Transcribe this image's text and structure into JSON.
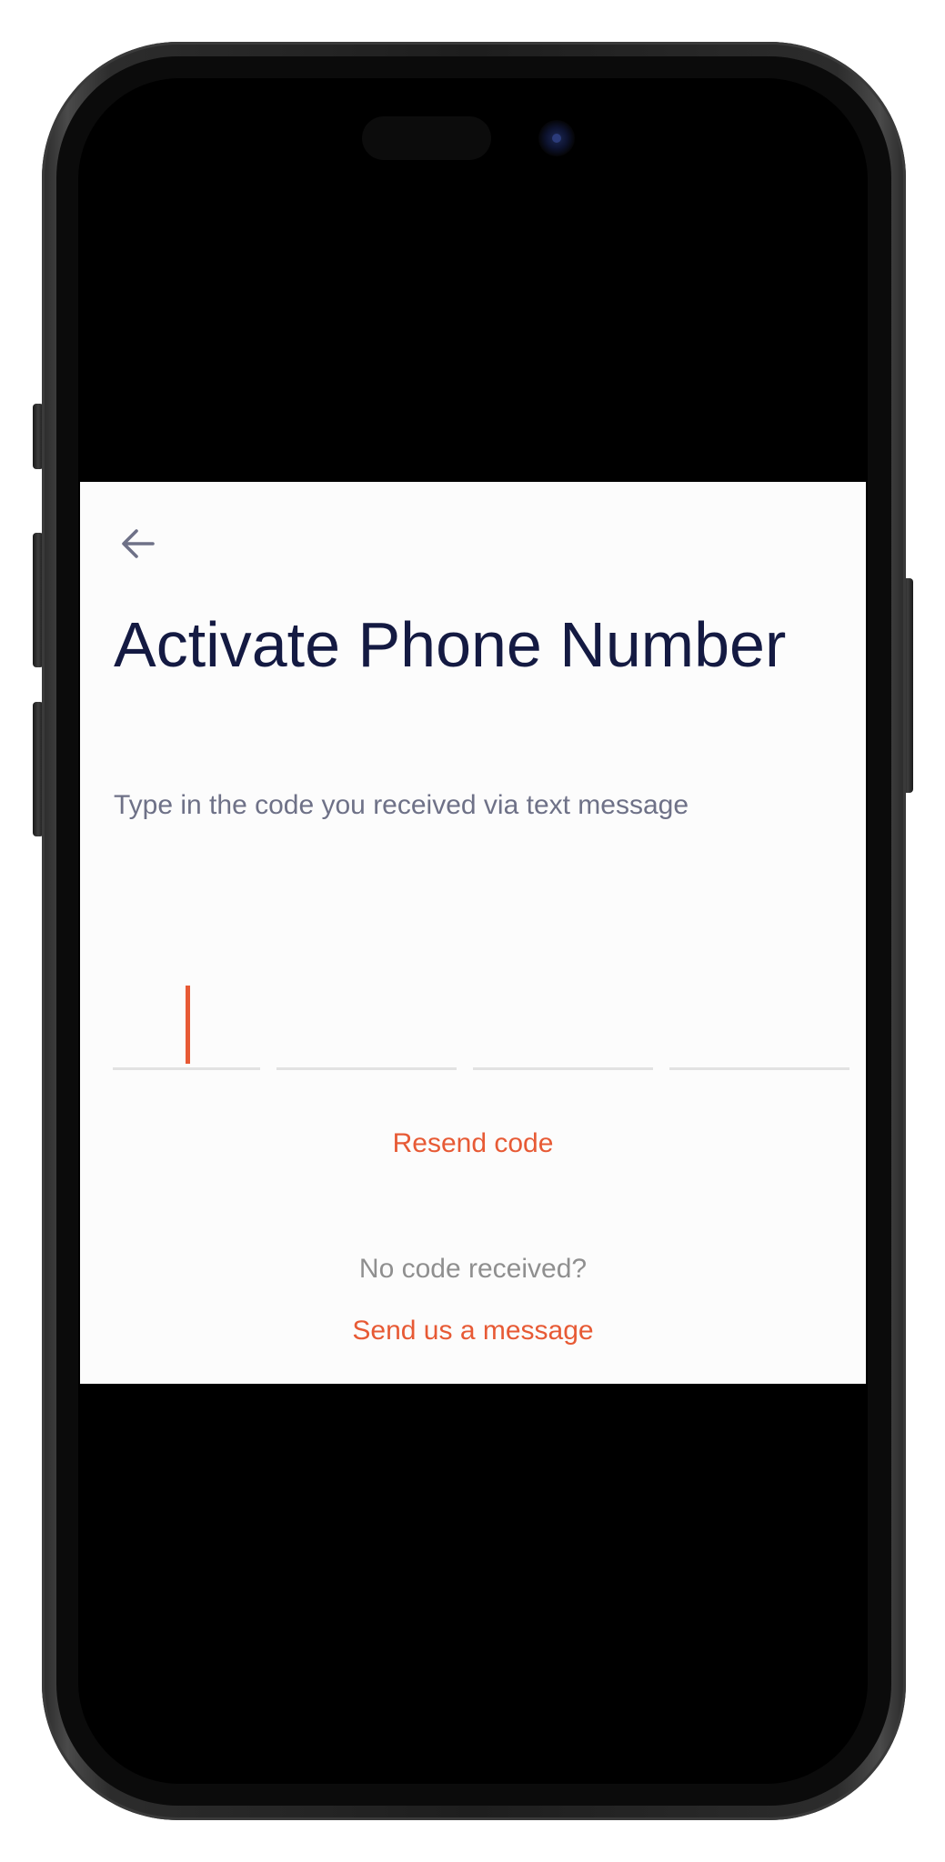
{
  "device": {
    "frame_color": "#1e1e1e",
    "screen_background": "#000000"
  },
  "screen": {
    "background": "#fcfcfc",
    "back_icon": "arrow-left-icon",
    "title": "Activate Phone Number",
    "subtitle": "Type in the code you received via text message",
    "code": {
      "digits": [
        "",
        "",
        "",
        ""
      ],
      "active_index": 0
    },
    "resend_label": "Resend code",
    "no_code_text": "No code received?",
    "send_message_label": "Send us a message"
  },
  "colors": {
    "title": "#141a42",
    "subtitle": "#6e7187",
    "accent": "#e75a35",
    "muted": "#8f8f8f",
    "underline": "#e2e2e2"
  }
}
